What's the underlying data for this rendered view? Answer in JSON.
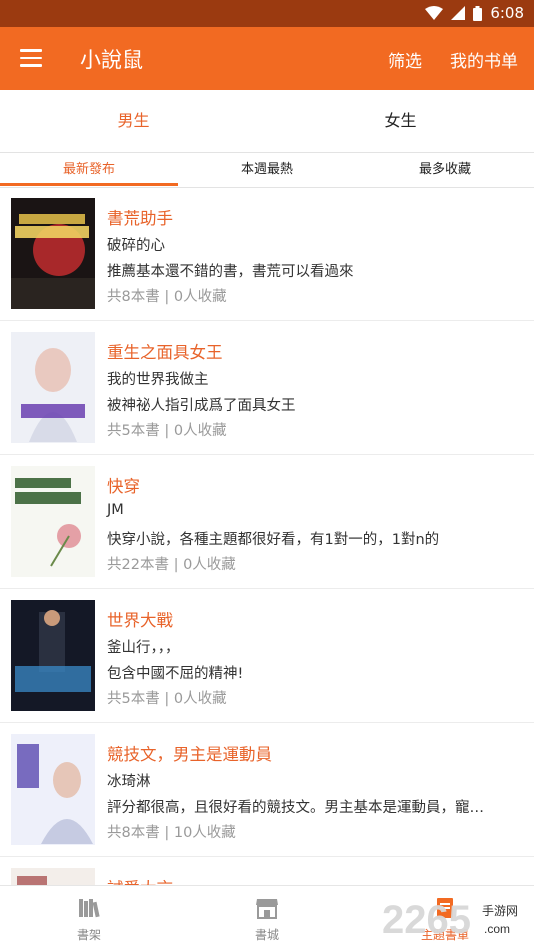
{
  "status_bar": {
    "time": "6:08",
    "icons": [
      "wifi-icon",
      "signal-icon",
      "battery-icon"
    ]
  },
  "app_bar": {
    "title": "小說鼠",
    "actions": [
      "筛选",
      "我的书单"
    ],
    "menu_icon": "menu-icon",
    "color": "#f26a22"
  },
  "gender_tabs": [
    {
      "label": "男生",
      "active": true
    },
    {
      "label": "女生",
      "active": false
    }
  ],
  "sort_tabs": [
    {
      "label": "最新發布",
      "active": true
    },
    {
      "label": "本週最熱",
      "active": false
    },
    {
      "label": "最多收藏",
      "active": false
    }
  ],
  "book_lists": [
    {
      "title": "書荒助手",
      "author": "破碎的心",
      "desc": "推薦基本還不錯的書，書荒可以看過來",
      "count": "共8本書",
      "favs": "0人收藏"
    },
    {
      "title": "重生之面具女王",
      "author": "我的世界我做主",
      "desc": "被神祕人指引成爲了面具女王",
      "count": "共5本書",
      "favs": "0人收藏"
    },
    {
      "title": "快穿",
      "author": "JM",
      "desc": "快穿小說，各種主題都很好看，有1對一的，1對n的",
      "count": "共22本書",
      "favs": "0人收藏"
    },
    {
      "title": "世界大戰",
      "author": "釜山行，，，",
      "desc": "包含中國不屈的精神!",
      "count": "共5本書",
      "favs": "0人收藏"
    },
    {
      "title": "競技文，男主是運動員",
      "author": "冰琦淋",
      "desc": "評分都很高，且很好看的競技文。男主基本是運動員，寵…",
      "count": "共8本書",
      "favs": "10人收藏"
    },
    {
      "title": "試愛大言",
      "author": "",
      "desc": "",
      "count": "",
      "favs": ""
    }
  ],
  "bottom_nav": [
    {
      "label": "書架",
      "icon": "bookshelf-icon",
      "active": false
    },
    {
      "label": "書城",
      "icon": "store-icon",
      "active": false
    },
    {
      "label": "主題書單",
      "icon": "booklist-icon",
      "active": true
    }
  ],
  "watermark": {
    "text": "2265",
    "sub": "手游网",
    "domain": ".com"
  },
  "meta_separator": "|",
  "accent_color": "#e8632a"
}
